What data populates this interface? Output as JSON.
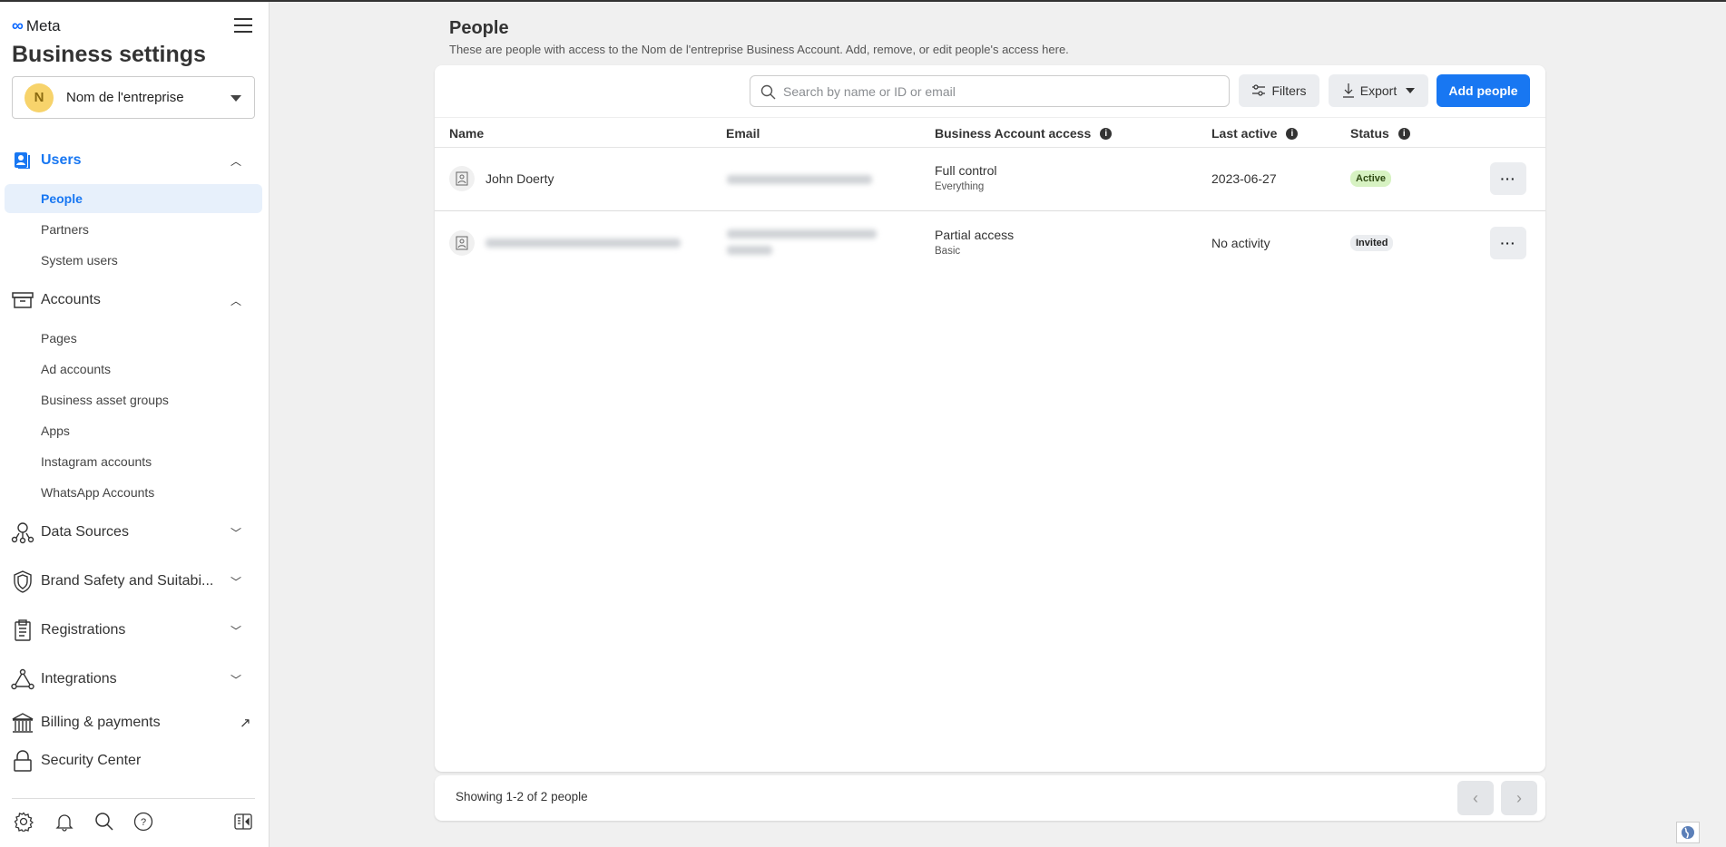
{
  "sidebar": {
    "logo": "Meta",
    "title": "Business settings",
    "company": {
      "initial": "N",
      "name": "Nom de l'entreprise"
    },
    "users": {
      "label": "Users",
      "items": [
        "People",
        "Partners",
        "System users"
      ]
    },
    "accounts": {
      "label": "Accounts",
      "items": [
        "Pages",
        "Ad accounts",
        "Business asset groups",
        "Apps",
        "Instagram accounts",
        "WhatsApp Accounts"
      ]
    },
    "sections": [
      "Data Sources",
      "Brand Safety and Suitabi...",
      "Registrations",
      "Integrations",
      "Billing & payments",
      "Security Center"
    ]
  },
  "main": {
    "title": "People",
    "subtitle": "These are people with access to the Nom de l'entreprise Business Account. Add, remove, or edit people's access here.",
    "search_placeholder": "Search by name or ID or email",
    "filters_label": "Filters",
    "export_label": "Export",
    "add_label": "Add people",
    "columns": [
      "Name",
      "Email",
      "Business Account access",
      "Last active",
      "Status"
    ],
    "rows": [
      {
        "name": "John Doerty",
        "access": "Full control",
        "access_detail": "Everything",
        "last_active": "2023-06-27",
        "status": "Active"
      },
      {
        "name": "",
        "access": "Partial access",
        "access_detail": "Basic",
        "last_active": "No activity",
        "status": "Invited"
      }
    ],
    "footer": "Showing 1-2 of 2 people"
  },
  "colors": {
    "accent": "#1877f2",
    "active_badge": "#d7f2c2",
    "invited_badge": "#ebedf0"
  }
}
